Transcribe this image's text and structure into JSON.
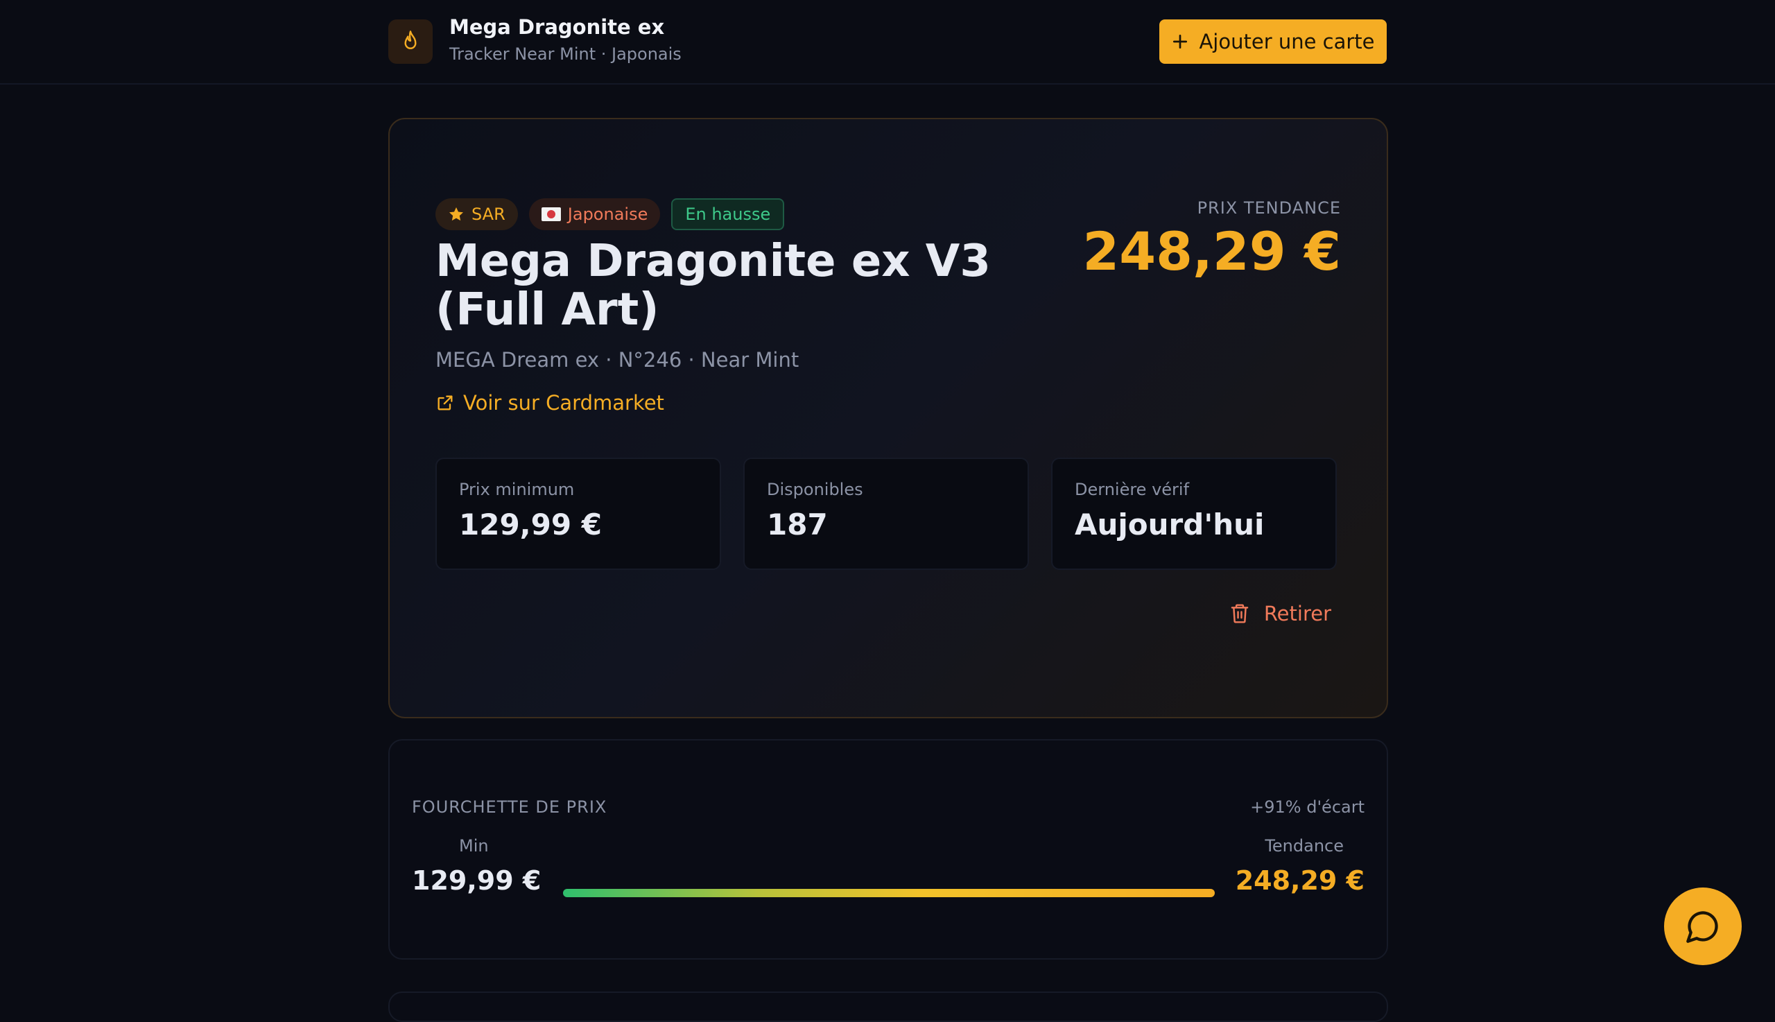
{
  "header": {
    "title": "Mega Dragonite ex",
    "subtitle": "Tracker Near Mint · Japonais",
    "add_button_label": "Ajouter une carte",
    "logo_icon": "flame-icon"
  },
  "card": {
    "badges": [
      {
        "label": "SAR",
        "icon": "star-icon"
      },
      {
        "label": "Japonaise",
        "icon": "japan-flag-icon"
      },
      {
        "label": "En hausse"
      }
    ],
    "title": "Mega Dragonite ex V3 (Full Art)",
    "meta": "MEGA Dream ex · N°246 · Near Mint",
    "link_label": "Voir sur Cardmarket",
    "trend_label": "PRIX TENDANCE",
    "trend_price": "248,29 €",
    "stats": [
      {
        "label": "Prix minimum",
        "value": "129,99 €"
      },
      {
        "label": "Disponibles",
        "value": "187"
      },
      {
        "label": "Dernière vérif",
        "value": "Aujourd'hui"
      }
    ],
    "remove_label": "Retirer"
  },
  "range": {
    "title": "FOURCHETTE DE PRIX",
    "spread": "+91% d'écart",
    "min_label": "Min",
    "min_value": "129,99 €",
    "max_label": "Tendance",
    "max_value": "248,29 €"
  },
  "colors": {
    "accent": "#f5ad24",
    "danger": "#f07a5a",
    "success": "#3ec98a",
    "background": "#0a0c14"
  }
}
